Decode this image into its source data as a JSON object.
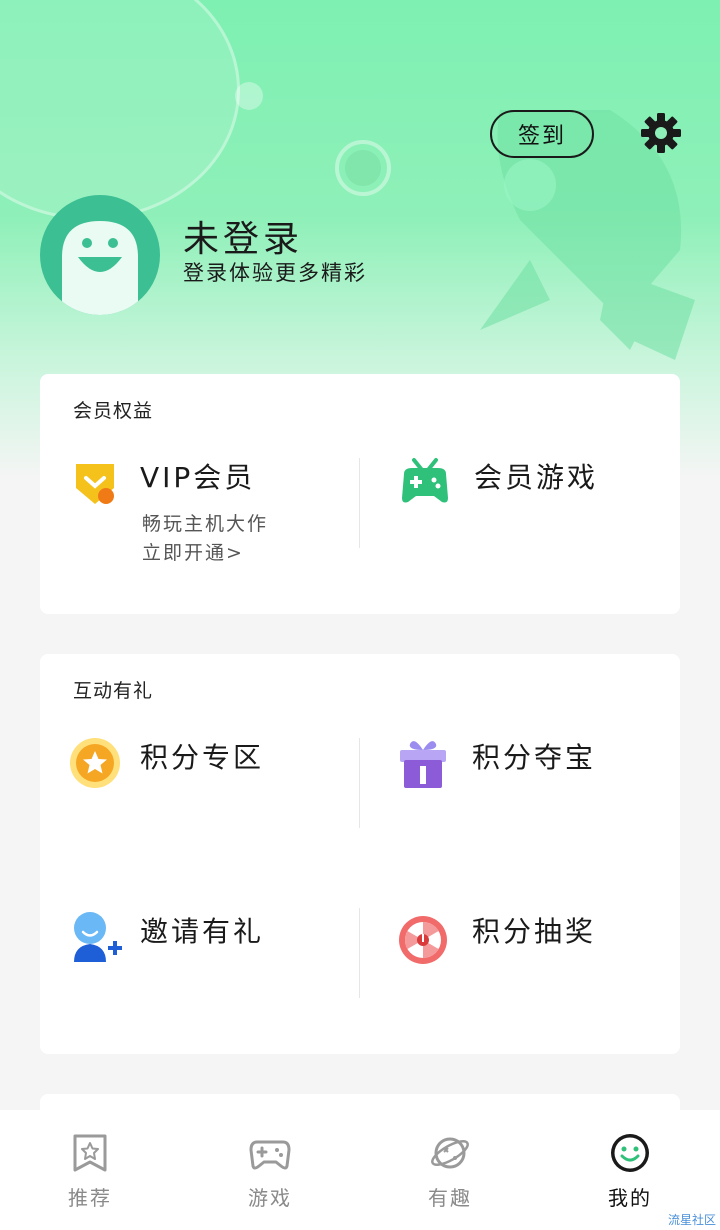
{
  "header": {
    "signin_label": "签到",
    "user_name": "未登录",
    "user_subtitle": "登录体验更多精彩"
  },
  "membership": {
    "title": "会员权益",
    "vip": {
      "label": "VIP会员",
      "desc_line1": "畅玩主机大作",
      "desc_line2": "立即开通>"
    },
    "games": {
      "label": "会员游戏"
    }
  },
  "activities": {
    "title": "互动有礼",
    "items": [
      {
        "label": "积分专区",
        "icon": "star-coin-icon"
      },
      {
        "label": "积分夺宝",
        "icon": "gift-box-icon"
      },
      {
        "label": "邀请有礼",
        "icon": "invite-user-icon"
      },
      {
        "label": "积分抽奖",
        "icon": "lottery-wheel-icon"
      }
    ]
  },
  "tabs": [
    {
      "label": "推荐",
      "icon": "recommend-icon",
      "active": false
    },
    {
      "label": "游戏",
      "icon": "gamepad-icon",
      "active": false
    },
    {
      "label": "有趣",
      "icon": "planet-icon",
      "active": false
    },
    {
      "label": "我的",
      "icon": "smiley-icon",
      "active": true
    }
  ],
  "watermark": "流星社区",
  "colors": {
    "header_green": "#7ef0b2",
    "avatar_green": "#3cbf93",
    "vip_yellow": "#f5c21c",
    "game_green": "#2fc07a",
    "gift_purple": "#8b5bd8",
    "invite_blue": "#4aa8f0",
    "lottery_red": "#f26b6b"
  }
}
